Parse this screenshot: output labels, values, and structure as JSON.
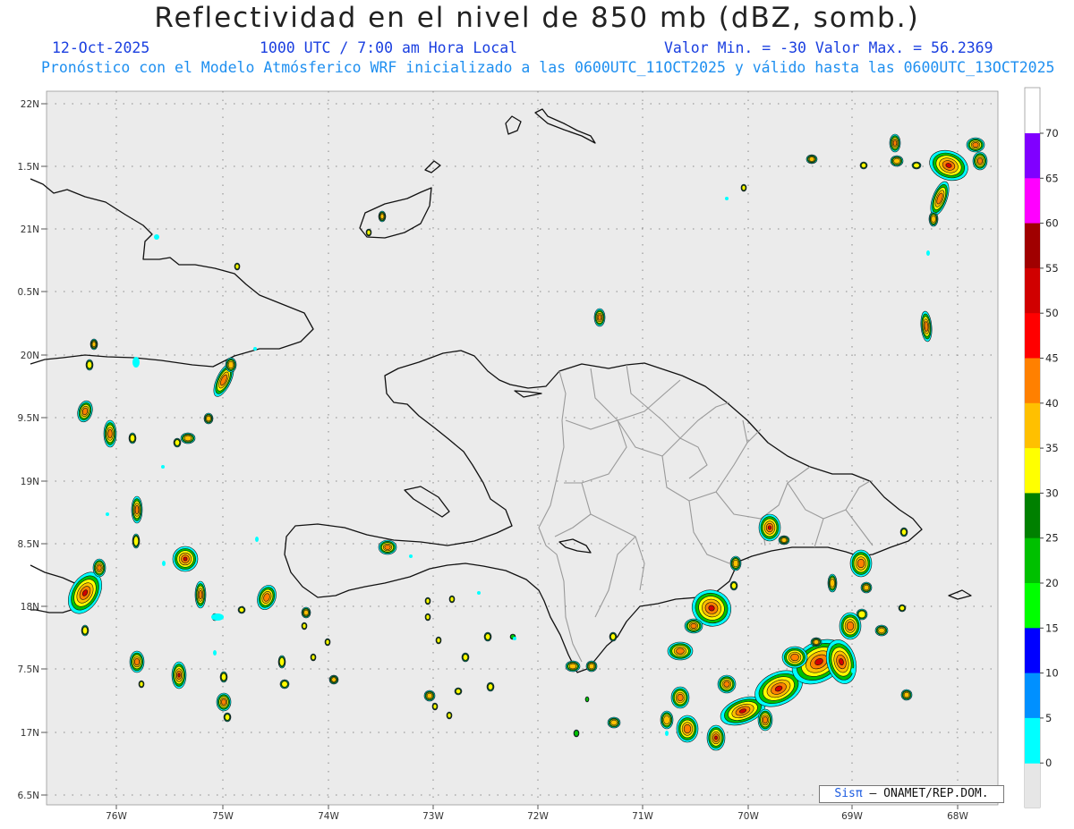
{
  "header": {
    "title": "Reflectividad en el nivel de 850 mb (dBZ, somb.)",
    "date": "12-Oct-2025",
    "time": "1000 UTC / 7:00 am Hora Local",
    "minmax": "Valor Min. = -30  Valor Max. = 56.2369",
    "forecast": "Pronóstico con el Modelo Atmósferico WRF inicializado a las 0600UTC_11OCT2025 y válido hasta las  0600UTC_13OCT2025"
  },
  "axes": {
    "lat_labels": [
      "22N",
      "1.5N",
      "21N",
      "0.5N",
      "20N",
      "9.5N",
      "19N",
      "8.5N",
      "18N",
      "7.5N",
      "17N",
      "6.5N"
    ],
    "lon_labels": [
      "76W",
      "75W",
      "74W",
      "73W",
      "72W",
      "71W",
      "70W",
      "69W",
      "68W"
    ]
  },
  "colorbar": {
    "labels": [
      "70",
      "65",
      "60",
      "55",
      "50",
      "45",
      "40",
      "35",
      "30",
      "25",
      "20",
      "15",
      "10",
      "5",
      "0"
    ],
    "colors": [
      "#8000ff",
      "#ff00ff",
      "#a00000",
      "#d00000",
      "#ff0000",
      "#ff8000",
      "#ffc000",
      "#ffff00",
      "#008000",
      "#00c000",
      "#00ff00",
      "#0000ff",
      "#0090ff",
      "#00ffff"
    ]
  },
  "credit": {
    "brand": "Sisπ",
    "rest": "– ONAMET/REP.DOM."
  }
}
